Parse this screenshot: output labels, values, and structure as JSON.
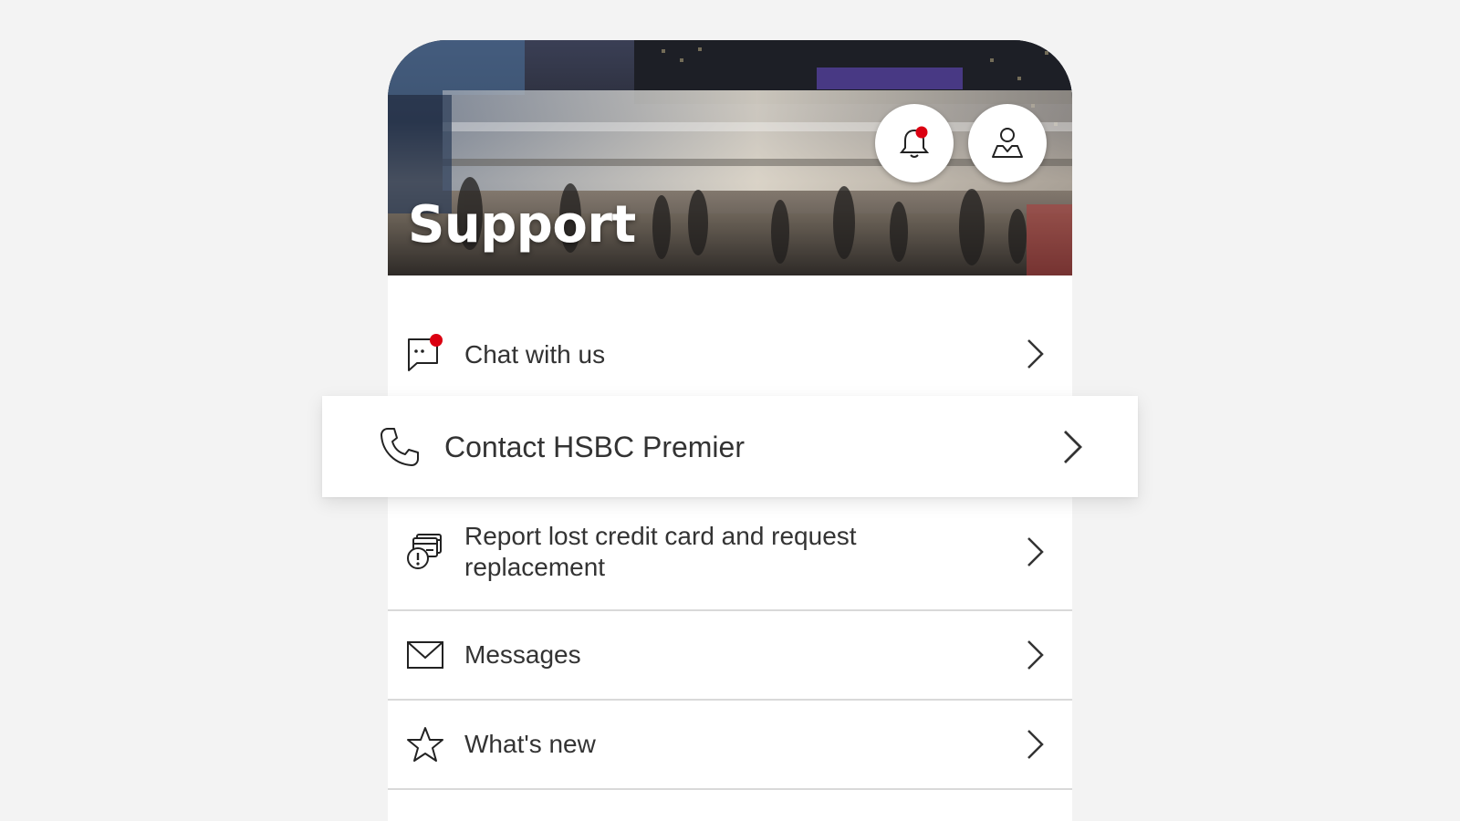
{
  "header": {
    "title": "Support",
    "notifications_icon": "bell-icon",
    "notifications_badge": true,
    "profile_icon": "profile-icon"
  },
  "menu": {
    "items": [
      {
        "label": "Chat with us",
        "icon": "chat-icon",
        "badge": true
      },
      {
        "label": "Contact HSBC Premier",
        "icon": "phone-icon",
        "highlighted": true
      },
      {
        "label": "Report lost credit card and request replacement",
        "icon": "lost-card-icon"
      },
      {
        "label": "Messages",
        "icon": "envelope-icon"
      },
      {
        "label": "What's new",
        "icon": "star-icon"
      }
    ]
  },
  "colors": {
    "background": "#f3f3f3",
    "card": "#ffffff",
    "text": "#333333",
    "badge": "#db0011",
    "divider": "#d9d9d9"
  }
}
